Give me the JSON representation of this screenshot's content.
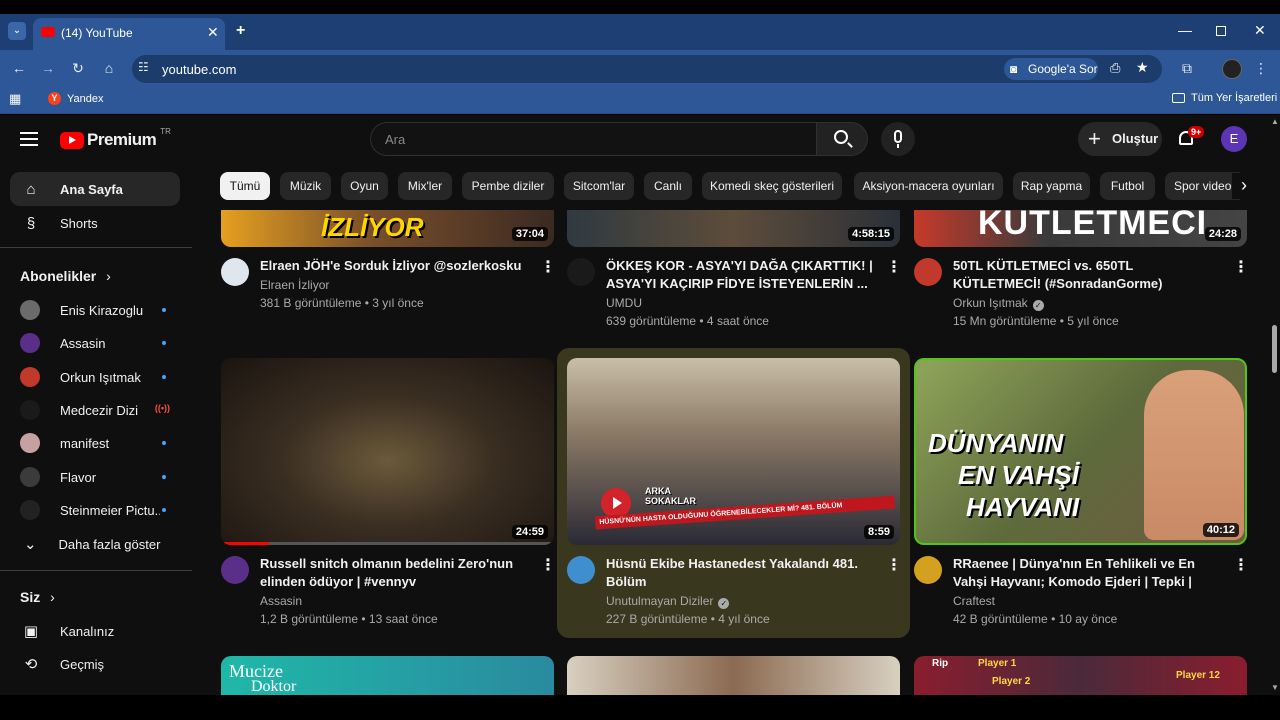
{
  "browser": {
    "tab_title": "(14) YouTube",
    "url": "youtube.com",
    "ask_google": "Google'a Sor",
    "bookmarks": {
      "yandex": "Yandex",
      "all": "Tüm Yer İşaretleri"
    }
  },
  "header": {
    "logo": "Premium",
    "region": "TR",
    "search_placeholder": "Ara",
    "create_label": "Oluştur",
    "notifications_count": "9+",
    "avatar_letter": "E"
  },
  "sidebar": {
    "home": "Ana Sayfa",
    "shorts": "Shorts",
    "subs_header": "Abonelikler",
    "subscriptions": [
      {
        "name": "Enis Kirazoglu",
        "color": "#6b6b6b",
        "status": "dot"
      },
      {
        "name": "Assasin",
        "color": "#5a2f8a",
        "status": "dot"
      },
      {
        "name": "Orkun Işıtmak",
        "color": "#c0392b",
        "status": "dot"
      },
      {
        "name": "Medcezir Dizi",
        "color": "#1a1a1a",
        "status": "live"
      },
      {
        "name": "manifest",
        "color": "#c7a1a1",
        "status": "dot"
      },
      {
        "name": "Flavor",
        "color": "#3b3b3b",
        "status": "dot"
      },
      {
        "name": "Steinmeier Pictu...",
        "color": "#222222",
        "status": "dot"
      }
    ],
    "show_more": "Daha fazla göster",
    "you_header": "Siz",
    "you_items": [
      "Kanalınız",
      "Geçmiş"
    ]
  },
  "chips": [
    "Tümü",
    "Müzik",
    "Oyun",
    "Mix'ler",
    "Pembe diziler",
    "Sitcom'lar",
    "Canlı",
    "Komedi skeç gösterileri",
    "Aksiyon-macera oyunları",
    "Rap yapma",
    "Futbol",
    "Spor video"
  ],
  "videos_row1": [
    {
      "title": "Elraen JÖH'e Sorduk İzliyor @sozlerkosku",
      "channel": "Elraen İzliyor",
      "meta": "381 B görüntüleme • 3 yıl önce",
      "duration": "37:04",
      "thumb_text": "İZLİYOR",
      "verified": false
    },
    {
      "title": "ÖKKEŞ KOR - ASYA'YI DAĞA ÇIKARTTIK! | ASYA'YI KAÇIRIP FİDYE İSTEYENLERİN ...",
      "channel": "UMDU",
      "meta": "639 görüntüleme • 4 saat önce",
      "duration": "4:58:15",
      "verified": false
    },
    {
      "title": "50TL KÜTLETMECİ vs. 650TL KÜTLETMECİ! (#SonradanGorme)",
      "channel": "Orkun Işıtmak",
      "meta": "15 Mn görüntüleme • 5 yıl önce",
      "duration": "24:28",
      "thumb_text": "KÜTLETMECİ",
      "verified": true
    }
  ],
  "videos_row2": [
    {
      "title": "Russell snitch olmanın bedelini Zero'nun elinden ödüyor | #vennyv",
      "channel": "Assasin",
      "meta": "1,2 B görüntüleme • 13 saat önce",
      "duration": "24:59",
      "verified": false
    },
    {
      "title": "Hüsnü Ekibe Hastanedest Yakalandı 481. Bölüm",
      "channel": "Unutulmayan Diziler",
      "meta": "227 B görüntüleme • 4 yıl önce",
      "duration": "8:59",
      "thumb_text_1": "ARKA SOKAKLAR",
      "thumb_text_2": "HÜSNÜ'NÜN HASTA OLDUĞUNU ÖĞRENEBİLECEKLER Mİ? 481. BÖLÜM",
      "verified": true
    },
    {
      "title": "RRaenee | Dünya'nın En Tehlikeli ve En Vahşi Hayvanı; Komodo Ejderi | Tepki | @Doğanay ...",
      "channel": "Craftest",
      "meta": "42 B görüntüleme • 10 ay önce",
      "duration": "40:12",
      "thumb_text_1": "DÜNYANIN",
      "thumb_text_2": "EN VAHŞİ",
      "thumb_text_3": "HAYVANI",
      "verified": false
    }
  ],
  "row3_texts": {
    "mucize": "Mucize",
    "doktor": "Doktor",
    "rip": "Rip",
    "player1": "Player 1",
    "player2": "Player 2",
    "player12": "Player 12"
  }
}
